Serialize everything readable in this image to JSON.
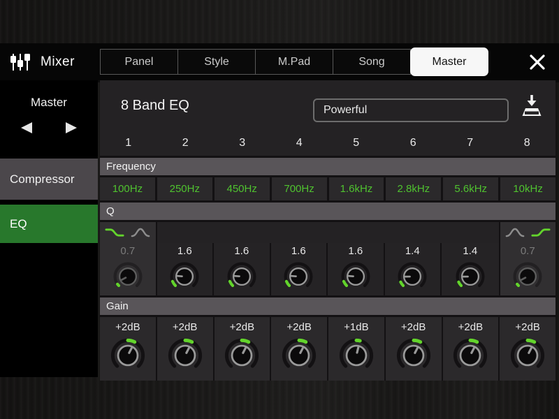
{
  "header": {
    "app_title": "Mixer",
    "tabs": [
      {
        "label": "Panel",
        "active": false
      },
      {
        "label": "Style",
        "active": false
      },
      {
        "label": "M.Pad",
        "active": false
      },
      {
        "label": "Song",
        "active": false
      },
      {
        "label": "Master",
        "active": true
      }
    ],
    "close_icon": "close-x"
  },
  "sidebar": {
    "selector_label": "Master",
    "prev_icon": "left-arrow",
    "next_icon": "right-arrow",
    "items": [
      {
        "label": "Compressor",
        "active": false
      },
      {
        "label": "EQ",
        "active": true
      }
    ]
  },
  "main": {
    "title": "8 Band EQ",
    "preset_value": "Powerful",
    "save_icon": "save-to-disk",
    "band_numbers": [
      "1",
      "2",
      "3",
      "4",
      "5",
      "6",
      "7",
      "8"
    ],
    "frequency": {
      "label": "Frequency",
      "values": [
        "100Hz",
        "250Hz",
        "450Hz",
        "700Hz",
        "1.6kHz",
        "2.8kHz",
        "5.6kHz",
        "10kHz"
      ]
    },
    "q": {
      "label": "Q",
      "values": [
        "0.7",
        "1.6",
        "1.6",
        "1.6",
        "1.6",
        "1.4",
        "1.4",
        "0.7"
      ],
      "band1_icons": [
        {
          "name": "shelf-falling-icon",
          "active": true
        },
        {
          "name": "peak-icon",
          "active": false
        }
      ],
      "band8_icons": [
        {
          "name": "peak-icon",
          "active": false
        },
        {
          "name": "shelf-rising-icon",
          "active": true
        }
      ],
      "knobs": [
        {
          "dim": true,
          "pointer": -118,
          "green": [
            -135,
            -126
          ]
        },
        {
          "dim": false,
          "pointer": -85,
          "green": [
            -135,
            -112
          ]
        },
        {
          "dim": false,
          "pointer": -85,
          "green": [
            -135,
            -112
          ]
        },
        {
          "dim": false,
          "pointer": -85,
          "green": [
            -135,
            -112
          ]
        },
        {
          "dim": false,
          "pointer": -85,
          "green": [
            -135,
            -112
          ]
        },
        {
          "dim": false,
          "pointer": -91,
          "green": [
            -135,
            -115
          ]
        },
        {
          "dim": false,
          "pointer": -91,
          "green": [
            -135,
            -115
          ]
        },
        {
          "dim": true,
          "pointer": -118,
          "green": [
            -135,
            -126
          ]
        }
      ]
    },
    "gain": {
      "label": "Gain",
      "values": [
        "+2dB",
        "+2dB",
        "+2dB",
        "+2dB",
        "+1dB",
        "+2dB",
        "+2dB",
        "+2dB"
      ],
      "knobs": [
        {
          "dim": false,
          "pointer": 27,
          "green": [
            0,
            27
          ]
        },
        {
          "dim": false,
          "pointer": 27,
          "green": [
            0,
            27
          ]
        },
        {
          "dim": false,
          "pointer": 27,
          "green": [
            0,
            27
          ]
        },
        {
          "dim": false,
          "pointer": 27,
          "green": [
            0,
            27
          ]
        },
        {
          "dim": false,
          "pointer": 14,
          "green": [
            0,
            14
          ]
        },
        {
          "dim": false,
          "pointer": 27,
          "green": [
            0,
            27
          ]
        },
        {
          "dim": false,
          "pointer": 27,
          "green": [
            0,
            27
          ]
        },
        {
          "dim": false,
          "pointer": 27,
          "green": [
            0,
            27
          ]
        }
      ]
    }
  },
  "colors": {
    "accent_green": "#4fc22f",
    "knob_green": "#63d42c",
    "eq_active_bg": "#28782c"
  }
}
